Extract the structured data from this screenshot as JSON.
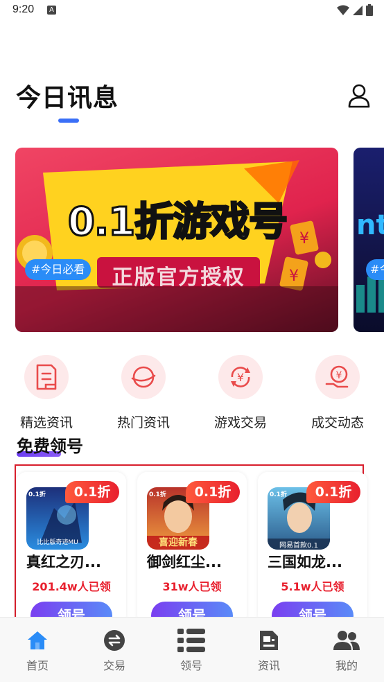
{
  "status_bar": {
    "time": "9:20",
    "notification_letter": "A"
  },
  "header": {
    "title": "今日讯息",
    "profile_icon": "user-outline-icon"
  },
  "banners": [
    {
      "headline": "0.1折游戏号",
      "subline": "正版官方授权",
      "tag": "#今日必看"
    },
    {
      "tag": "#今日必看"
    }
  ],
  "categories": [
    {
      "label": "精选资讯",
      "icon": "document-icon"
    },
    {
      "label": "热门资讯",
      "icon": "planet-icon"
    },
    {
      "label": "游戏交易",
      "icon": "yen-exchange-icon"
    },
    {
      "label": "成交动态",
      "icon": "yen-hand-icon"
    }
  ],
  "free_section": {
    "title": "免费领号",
    "cards": [
      {
        "badge": "0.1折",
        "name": "真红之刃...",
        "count": "201.4w人已领",
        "button": "领号",
        "thumb_small": "0.1折",
        "thumb_caption": "比比版奇迹MU"
      },
      {
        "badge": "0.1折",
        "name": "御剑红尘...",
        "count": "31w人已领",
        "button": "领号",
        "thumb_small": "0.1折",
        "thumb_caption": "喜迎新春"
      },
      {
        "badge": "0.1折",
        "name": "三国如龙...",
        "count": "5.1w人已领",
        "button": "领号",
        "thumb_small": "0.1折",
        "thumb_caption": "网易首款0.1"
      }
    ]
  },
  "bottom_nav": [
    {
      "label": "首页",
      "icon": "home-icon",
      "active": true
    },
    {
      "label": "交易",
      "icon": "exchange-icon",
      "active": false
    },
    {
      "label": "领号",
      "icon": "list-icon",
      "active": false
    },
    {
      "label": "资讯",
      "icon": "news-icon",
      "active": false
    },
    {
      "label": "我的",
      "icon": "users-icon",
      "active": false
    }
  ],
  "colors": {
    "accent_blue": "#3a6ff7",
    "badge_red": "#e8202e",
    "button_purple": "#7a3ff0"
  }
}
